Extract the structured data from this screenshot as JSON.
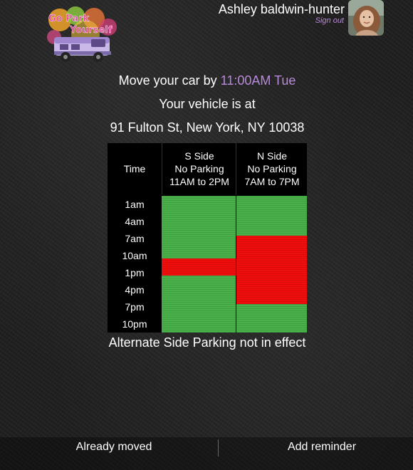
{
  "app": {
    "logo_text_line1": "Go Park",
    "logo_text_line2": "Yourself"
  },
  "user": {
    "name": "Ashley baldwin-hunter",
    "sign_out_label": "Sign out"
  },
  "info": {
    "move_prefix": "Move your car by ",
    "move_time": "11:00AM Tue",
    "vehicle_label": "Your vehicle is at",
    "address": "91 Fulton St, New York, NY 10038"
  },
  "schedule": {
    "time_header": "Time",
    "columns": [
      {
        "side": "S Side",
        "rule": "No Parking",
        "hours": "11AM to 2PM",
        "no_parking_start_hour": 11,
        "no_parking_end_hour": 14
      },
      {
        "side": "N Side",
        "rule": "No Parking",
        "hours": "7AM to 7PM",
        "no_parking_start_hour": 7,
        "no_parking_end_hour": 19
      }
    ],
    "time_labels": [
      "1am",
      "4am",
      "7am",
      "10am",
      "1pm",
      "4pm",
      "7pm",
      "10pm"
    ],
    "day_start_hour": 0,
    "day_end_hour": 24
  },
  "status_text": "Alternate Side Parking not in effect",
  "actions": {
    "already_moved_label": "Already moved",
    "add_reminder_label": "Add reminder"
  },
  "colors": {
    "accent": "#b98adb",
    "ok_parking": "#49b04a",
    "no_parking": "#ef0d0d"
  }
}
